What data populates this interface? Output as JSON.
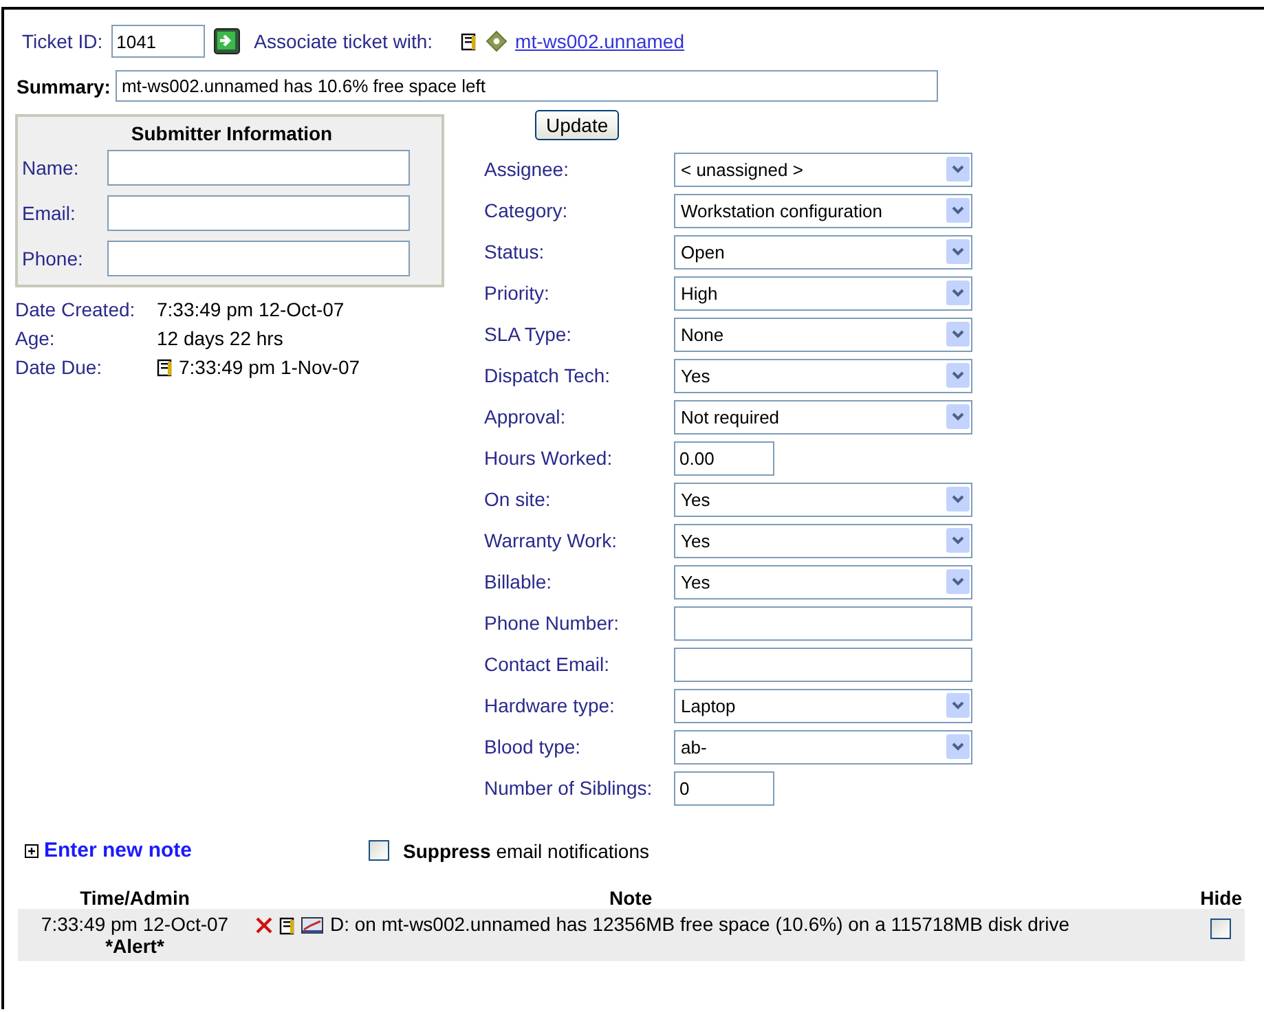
{
  "ticket": {
    "id_label": "Ticket ID:",
    "id_value": "1041",
    "associate_label": "Associate ticket with:",
    "associate_link": "mt-ws002.unnamed"
  },
  "summary": {
    "label": "Summary:",
    "value": "mt-ws002.unnamed has 10.6% free space left"
  },
  "submitter": {
    "title": "Submitter Information",
    "fields": [
      {
        "label": "Name:"
      },
      {
        "label": "Email:"
      },
      {
        "label": "Phone:"
      }
    ]
  },
  "dates": [
    {
      "label": "Date Created:",
      "value": "7:33:49 pm 12-Oct-07",
      "kind": "text"
    },
    {
      "label": "Age:",
      "value": "12 days 22 hrs",
      "kind": "text"
    },
    {
      "label": "Date Due:",
      "value": "7:33:49 pm 1-Nov-07",
      "kind": "calendar"
    }
  ],
  "update_button": "Update",
  "fields": [
    {
      "label": "Assignee:",
      "kind": "select",
      "value": "< unassigned >"
    },
    {
      "label": "Category:",
      "kind": "select",
      "value": "Workstation configuration"
    },
    {
      "label": "Status:",
      "kind": "select",
      "value": "Open"
    },
    {
      "label": "Priority:",
      "kind": "select",
      "value": "High"
    },
    {
      "label": "SLA Type:",
      "kind": "select",
      "value": "None"
    },
    {
      "label": "Dispatch Tech:",
      "kind": "select",
      "value": "Yes"
    },
    {
      "label": "Approval:",
      "kind": "select",
      "value": "Not required"
    },
    {
      "label": "Hours Worked:",
      "kind": "number",
      "value": "0.00"
    },
    {
      "label": "On site:",
      "kind": "select",
      "value": "Yes"
    },
    {
      "label": "Warranty Work:",
      "kind": "select",
      "value": "Yes"
    },
    {
      "label": "Billable:",
      "kind": "select",
      "value": "Yes"
    },
    {
      "label": "Phone Number:",
      "kind": "text"
    },
    {
      "label": "Contact Email:",
      "kind": "text"
    },
    {
      "label": "Hardware type:",
      "kind": "select",
      "value": "Laptop"
    },
    {
      "label": "Blood type:",
      "kind": "select",
      "value": "ab-"
    },
    {
      "label": "Number of Siblings:",
      "kind": "number",
      "value": "0"
    }
  ],
  "notes": {
    "enter_label": "Enter new note",
    "suppress": {
      "checked": false,
      "text": "**Suppress** email notifications"
    },
    "columns": [
      "Time/Admin",
      "Note",
      "Hide"
    ],
    "rows": [
      {
        "time": "7:33:49 pm 12-Oct-07",
        "admin": "*Alert*",
        "note": "D: on mt-ws002.unnamed has 12356MB free space (10.6%) on a 115718MB disk drive",
        "hidden": false
      }
    ]
  }
}
